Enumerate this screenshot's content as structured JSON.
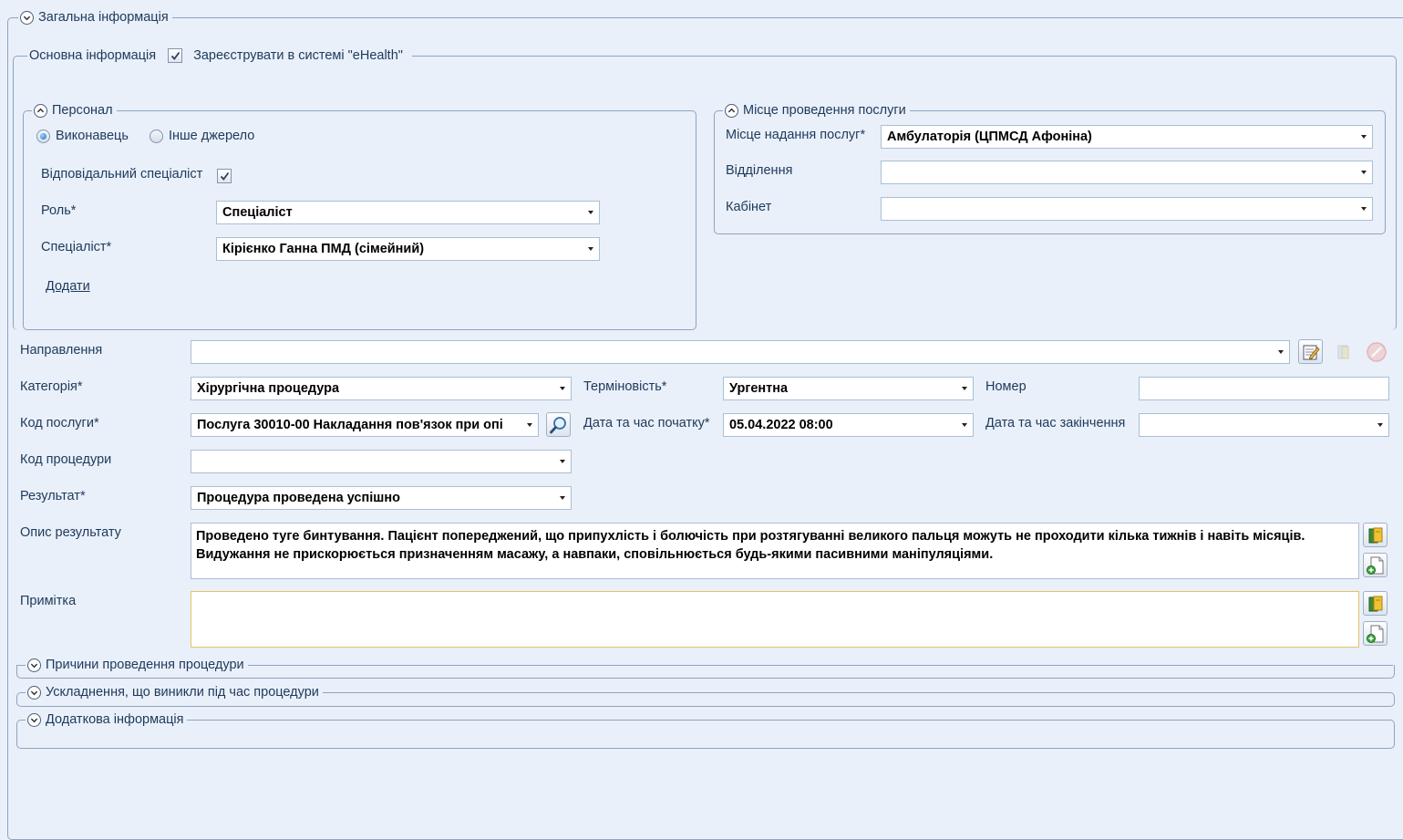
{
  "sections": {
    "general": "Загальна інформація",
    "personnel": "Персонал",
    "location": "Місце проведення послуги",
    "reasons": "Причини проведення процедури",
    "complications": "Ускладнення, що виникли під час процедури",
    "additional": "Додаткова інформація"
  },
  "main_info": {
    "label": "Основна інформація",
    "ehealth_label": "Зареєструвати в системі \"eHealth\"",
    "ehealth_checked": true
  },
  "personnel": {
    "radio_executor": "Виконавець",
    "radio_other": "Інше джерело",
    "selected_source": "Виконавець",
    "responsible_label": "Відповідальний спеціаліст",
    "responsible_checked": true,
    "role_label": "Роль*",
    "role_value": "Спеціаліст",
    "specialist_label": "Спеціаліст*",
    "specialist_value": "Кірієнко Ганна ПМД (сімейний)",
    "add_link": "Додати"
  },
  "location": {
    "place_label": "Місце надання послуг*",
    "place_value": "Амбулаторія (ЦПМСД Афоніна)",
    "department_label": "Відділення",
    "department_value": "",
    "cabinet_label": "Кабінет",
    "cabinet_value": ""
  },
  "form": {
    "referral_label": "Направлення",
    "referral_value": "",
    "category_label": "Категорія*",
    "category_value": "Хірургічна процедура",
    "urgency_label": "Терміновість*",
    "urgency_value": "Ургентна",
    "number_label": "Номер",
    "number_value": "",
    "service_code_label": "Код послуги*",
    "service_code_value": "Послуга 30010-00 Накладання пов'язок при опі",
    "start_label": "Дата та час початку*",
    "start_value": "05.04.2022 08:00",
    "end_label": "Дата та час закінчення",
    "end_value": "",
    "procedure_code_label": "Код процедури",
    "procedure_code_value": "",
    "result_label": "Результат*",
    "result_value": "Процедура проведена успішно",
    "result_desc_label": "Опис результату",
    "result_desc_value": "Проведено туге бинтування. Пацієнт попереджений, що припухлість і болючість при розтягуванні великого пальця можуть не проходити кілька тижнів і навіть місяців. Видужання не прискорюється призначенням масажу, а навпаки, сповільнюється будь-якими пасивними маніпуляціями.",
    "note_label": "Примітка",
    "note_value": ""
  },
  "icons": {
    "edit": "edit-referral-icon",
    "book": "book-icon",
    "cancel": "cancel-icon",
    "search": "magnifier-icon",
    "template": "template-book-icon",
    "add_doc": "add-document-icon"
  }
}
